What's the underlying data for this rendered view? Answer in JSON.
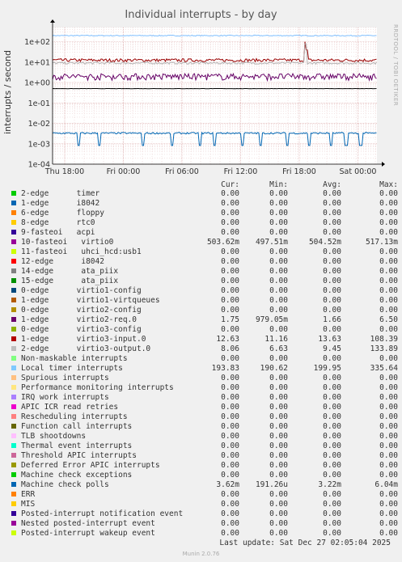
{
  "title": "Individual interrupts - by day",
  "side_label": "RRDTOOL / TOBI OETIKER",
  "chart_data": {
    "type": "line",
    "title": "Individual interrupts - by day",
    "ylabel": "interrupts / second",
    "yscale": "log",
    "ylim": [
      0.0001,
      500
    ],
    "ytick_labels": [
      "1e+02",
      "1e+01",
      "1e+00",
      "1e-01",
      "1e-02",
      "1e-03",
      "1e-04"
    ],
    "ytick_values": [
      100,
      10,
      1,
      0.1,
      0.01,
      0.001,
      0.0001
    ],
    "xtick_labels": [
      "Thu 18:00",
      "Fri 00:00",
      "Fri 06:00",
      "Fri 12:00",
      "Fri 18:00",
      "Sat 00:00"
    ],
    "grid": true,
    "series": [
      {
        "name": "Local timer interrupts",
        "color": "#80c0ff",
        "level": 199.95,
        "variation": 0.05,
        "spikes": []
      },
      {
        "name": "virtio3-input.0",
        "color": "#990000",
        "level": 12.5,
        "variation": 0.15,
        "spikes": [
          [
            0.78,
            100
          ],
          [
            0.785,
            40
          ]
        ]
      },
      {
        "name": "virtio3-output.0",
        "color": "#b3b3b3",
        "level": 9.0,
        "variation": 0.1,
        "spikes": [
          [
            0.78,
            80
          ]
        ]
      },
      {
        "name": "virtio2-req.0",
        "color": "#660066",
        "level": 1.6,
        "variation": 0.5,
        "spikes": []
      },
      {
        "name": "virtio0",
        "color": "#000000",
        "level": 0.5045,
        "variation": 0.01,
        "spikes": []
      },
      {
        "name": "Machine check polls",
        "color": "#0066b3",
        "level": 0.0033,
        "variation": 0.08,
        "dips": [
          0.08,
          0.145,
          0.28,
          0.37,
          0.455,
          0.5,
          0.585,
          0.64,
          0.725,
          0.79,
          0.86,
          0.905,
          0.95
        ]
      }
    ]
  },
  "legend_header": {
    "cur": "Cur:",
    "min": "Min:",
    "avg": "Avg:",
    "max": "Max:"
  },
  "legend": [
    {
      "name": "2-edge      timer",
      "color": "#00cc00",
      "cur": "0.00",
      "min": "0.00",
      "avg": "0.00",
      "max": "0.00"
    },
    {
      "name": "1-edge      i8042",
      "color": "#0066b3",
      "cur": "0.00",
      "min": "0.00",
      "avg": "0.00",
      "max": "0.00"
    },
    {
      "name": "6-edge      floppy",
      "color": "#ff8000",
      "cur": "0.00",
      "min": "0.00",
      "avg": "0.00",
      "max": "0.00"
    },
    {
      "name": "8-edge      rtc0",
      "color": "#ffcc00",
      "cur": "0.00",
      "min": "0.00",
      "avg": "0.00",
      "max": "0.00"
    },
    {
      "name": "9-fasteoi   acpi",
      "color": "#330099",
      "cur": "0.00",
      "min": "0.00",
      "avg": "0.00",
      "max": "0.00"
    },
    {
      "name": "10-fasteoi   virtio0",
      "color": "#990099",
      "cur": "503.62m",
      "min": "497.51m",
      "avg": "504.52m",
      "max": "517.13m"
    },
    {
      "name": "11-fasteoi   uhci_hcd:usb1",
      "color": "#ccff00",
      "cur": "0.00",
      "min": "0.00",
      "avg": "0.00",
      "max": "0.00"
    },
    {
      "name": "12-edge      i8042",
      "color": "#ff0000",
      "cur": "0.00",
      "min": "0.00",
      "avg": "0.00",
      "max": "0.00"
    },
    {
      "name": "14-edge      ata_piix",
      "color": "#808080",
      "cur": "0.00",
      "min": "0.00",
      "avg": "0.00",
      "max": "0.00"
    },
    {
      "name": "15-edge      ata_piix",
      "color": "#008f00",
      "cur": "0.00",
      "min": "0.00",
      "avg": "0.00",
      "max": "0.00"
    },
    {
      "name": "0-edge      virtio1-config",
      "color": "#00487d",
      "cur": "0.00",
      "min": "0.00",
      "avg": "0.00",
      "max": "0.00"
    },
    {
      "name": "1-edge      virtio1-virtqueues",
      "color": "#b35a00",
      "cur": "0.00",
      "min": "0.00",
      "avg": "0.00",
      "max": "0.00"
    },
    {
      "name": "0-edge      virtio2-config",
      "color": "#b38f00",
      "cur": "0.00",
      "min": "0.00",
      "avg": "0.00",
      "max": "0.00"
    },
    {
      "name": "1-edge      virtio2-req.0",
      "color": "#6b006b",
      "cur": "1.75",
      "min": "979.05m",
      "avg": "1.66",
      "max": "6.50"
    },
    {
      "name": "0-edge      virtio3-config",
      "color": "#8fb300",
      "cur": "0.00",
      "min": "0.00",
      "avg": "0.00",
      "max": "0.00"
    },
    {
      "name": "1-edge      virtio3-input.0",
      "color": "#b30000",
      "cur": "12.63",
      "min": "11.16",
      "avg": "13.63",
      "max": "108.39"
    },
    {
      "name": "2-edge      virtio3-output.0",
      "color": "#bebebe",
      "cur": "8.06",
      "min": "6.63",
      "avg": "9.45",
      "max": "133.89"
    },
    {
      "name": "Non-maskable interrupts",
      "color": "#80ff80",
      "cur": "0.00",
      "min": "0.00",
      "avg": "0.00",
      "max": "0.00"
    },
    {
      "name": "Local timer interrupts",
      "color": "#80c9ff",
      "cur": "193.83",
      "min": "190.62",
      "avg": "199.95",
      "max": "335.64"
    },
    {
      "name": "Spurious interrupts",
      "color": "#ffc080",
      "cur": "0.00",
      "min": "0.00",
      "avg": "0.00",
      "max": "0.00"
    },
    {
      "name": "Performance monitoring interrupts",
      "color": "#ffe680",
      "cur": "0.00",
      "min": "0.00",
      "avg": "0.00",
      "max": "0.00"
    },
    {
      "name": "IRQ work interrupts",
      "color": "#aa80ff",
      "cur": "0.00",
      "min": "0.00",
      "avg": "0.00",
      "max": "0.00"
    },
    {
      "name": "APIC ICR read retries",
      "color": "#ee00cc",
      "cur": "0.00",
      "min": "0.00",
      "avg": "0.00",
      "max": "0.00"
    },
    {
      "name": "Rescheduling interrupts",
      "color": "#ff8080",
      "cur": "0.00",
      "min": "0.00",
      "avg": "0.00",
      "max": "0.00"
    },
    {
      "name": "Function call interrupts",
      "color": "#666600",
      "cur": "0.00",
      "min": "0.00",
      "avg": "0.00",
      "max": "0.00"
    },
    {
      "name": "TLB shootdowns",
      "color": "#ffbfff",
      "cur": "0.00",
      "min": "0.00",
      "avg": "0.00",
      "max": "0.00"
    },
    {
      "name": "Thermal event interrupts",
      "color": "#00ffcc",
      "cur": "0.00",
      "min": "0.00",
      "avg": "0.00",
      "max": "0.00"
    },
    {
      "name": "Threshold APIC interrupts",
      "color": "#cc6699",
      "cur": "0.00",
      "min": "0.00",
      "avg": "0.00",
      "max": "0.00"
    },
    {
      "name": "Deferred Error APIC interrupts",
      "color": "#999900",
      "cur": "0.00",
      "min": "0.00",
      "avg": "0.00",
      "max": "0.00"
    },
    {
      "name": "Machine check exceptions",
      "color": "#00cc00",
      "cur": "0.00",
      "min": "0.00",
      "avg": "0.00",
      "max": "0.00"
    },
    {
      "name": "Machine check polls",
      "color": "#0066b3",
      "cur": "3.62m",
      "min": "191.26u",
      "avg": "3.22m",
      "max": "6.04m"
    },
    {
      "name": "ERR",
      "color": "#ff8000",
      "cur": "0.00",
      "min": "0.00",
      "avg": "0.00",
      "max": "0.00"
    },
    {
      "name": "MIS",
      "color": "#ffcc00",
      "cur": "0.00",
      "min": "0.00",
      "avg": "0.00",
      "max": "0.00"
    },
    {
      "name": "Posted-interrupt notification event",
      "color": "#330099",
      "cur": "0.00",
      "min": "0.00",
      "avg": "0.00",
      "max": "0.00"
    },
    {
      "name": "Nested posted-interrupt event",
      "color": "#990099",
      "cur": "0.00",
      "min": "0.00",
      "avg": "0.00",
      "max": "0.00"
    },
    {
      "name": "Posted-interrupt wakeup event",
      "color": "#ccff00",
      "cur": "0.00",
      "min": "0.00",
      "avg": "0.00",
      "max": "0.00"
    }
  ],
  "last_update": "Last update: Sat Dec 27 02:05:04 2025",
  "footer": "Munin 2.0.76"
}
